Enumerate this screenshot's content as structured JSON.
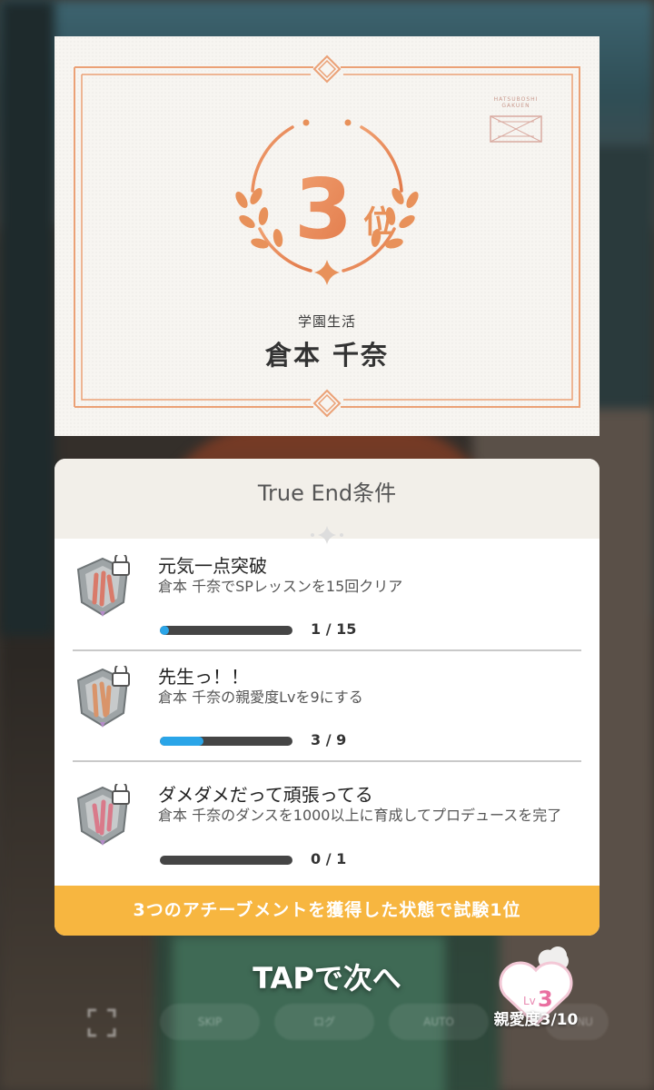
{
  "result": {
    "rank_number": "3",
    "rank_suffix": "位",
    "category": "学園生活",
    "name": "倉本 千奈",
    "stamp_text": "HATSUBOSHI GAKUEN"
  },
  "conditions": {
    "title": "True End条件",
    "items": [
      {
        "title": "元気一点突破",
        "description": "倉本 千奈でSPレッスンを15回クリア",
        "progress_text": "1 / 15",
        "progress": 0.067
      },
      {
        "title": "先生っ！！",
        "description": "倉本 千奈の親愛度Lvを9にする",
        "progress_text": "3 / 9",
        "progress": 0.333
      },
      {
        "title": "ダメダメだって頑張ってる",
        "description": "倉本 千奈のダンスを1000以上に育成してプロデュースを完了",
        "progress_text": "0 / 1",
        "progress": 0
      }
    ],
    "footer": "3つのアチーブメントを獲得した状態で試験1位"
  },
  "hud": {
    "tap_next": "TAPで次へ",
    "affinity_prefix": "Lv",
    "affinity_level": "3",
    "affinity_label": "親愛度3/10",
    "buttons": [
      "SKIP",
      "ログ",
      "AUTO",
      "MENU"
    ]
  },
  "colors": {
    "accent_orange": "#e8915a",
    "footer_yellow": "#f7b640",
    "progress_blue": "#2aa5e8"
  }
}
